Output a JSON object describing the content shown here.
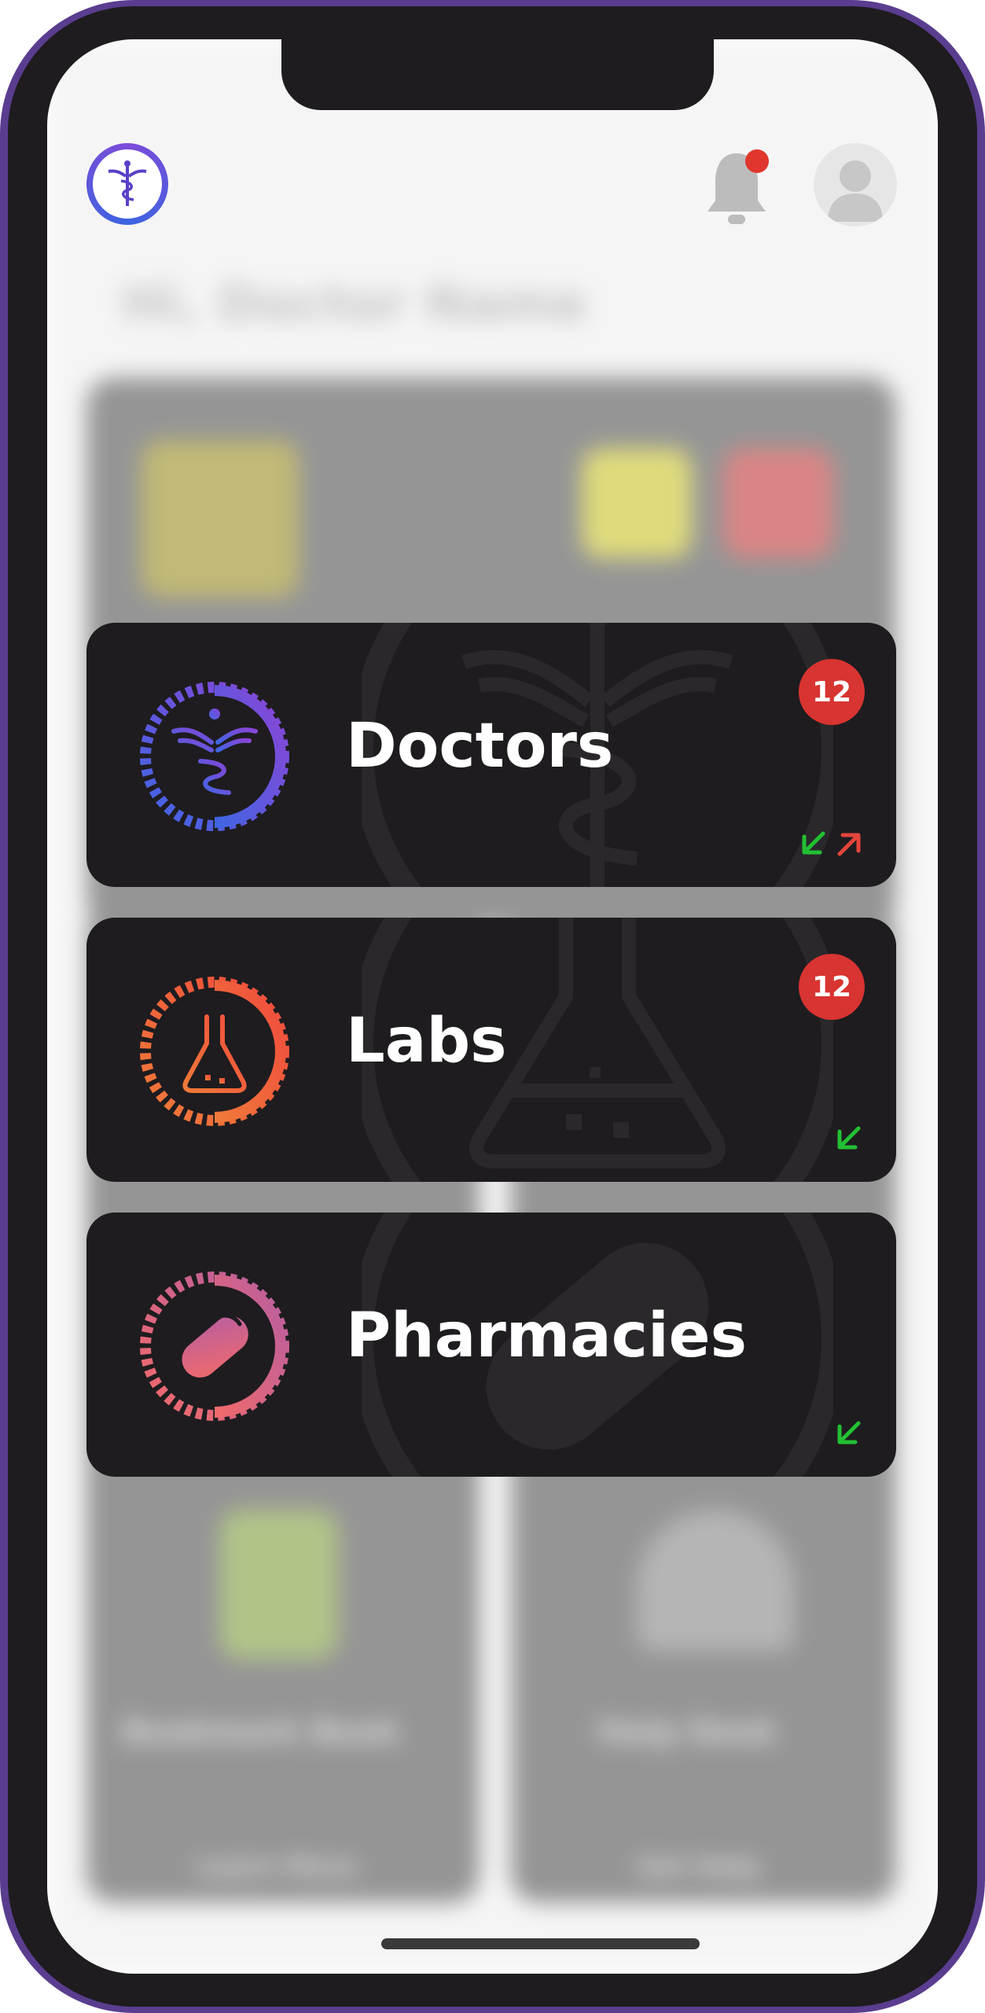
{
  "header": {
    "logo_icon": "caduceus-icon",
    "notification_icon": "bell-icon",
    "notification_dot_color": "#e0362d",
    "avatar_icon": "user-avatar-icon"
  },
  "greeting": "Hi, Doctor Name",
  "background_cards": [
    {
      "label": "Bookmark Book",
      "link": "Learn More"
    },
    {
      "label": "Help Desk",
      "link": "Get Help"
    }
  ],
  "categories": [
    {
      "label": "Doctors",
      "badge": "12",
      "icon": "caduceus-icon",
      "accent": [
        "#3f66e3",
        "#8a45d6"
      ],
      "arrows": [
        "arrow-down-left-icon",
        "arrow-up-right-icon"
      ]
    },
    {
      "label": "Labs",
      "badge": "12",
      "icon": "flask-icon",
      "accent": [
        "#f04b3c",
        "#f07a3a"
      ],
      "arrows": [
        "arrow-down-left-icon"
      ]
    },
    {
      "label": "Pharmacies",
      "badge": "",
      "icon": "pill-icon",
      "accent": [
        "#b95ea0",
        "#f06a6a"
      ],
      "arrows": [
        "arrow-down-left-icon"
      ]
    }
  ],
  "colors": {
    "card_bg": "#1e1c1f",
    "badge_bg": "#d83431",
    "arrow_in": "#22c033",
    "arrow_out": "#e5453a"
  }
}
